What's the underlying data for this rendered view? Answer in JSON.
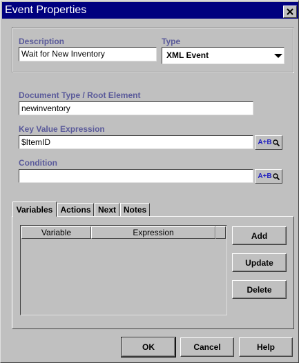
{
  "window": {
    "title": "Event Properties"
  },
  "header_group": {
    "description_label": "Description",
    "description_value": "Wait for New Inventory",
    "type_label": "Type",
    "type_value": "XML Event"
  },
  "doc_type": {
    "label": "Document Type / Root Element",
    "value": "newinventory"
  },
  "key_value": {
    "label": "Key Value Expression",
    "value": "$ItemID",
    "button_label": "A+B"
  },
  "condition": {
    "label": "Condition",
    "value": "",
    "button_label": "A+B"
  },
  "tabs": [
    {
      "label": "Variables"
    },
    {
      "label": "Actions"
    },
    {
      "label": "Next"
    },
    {
      "label": "Notes"
    }
  ],
  "variables_table": {
    "columns": [
      "Variable",
      "Expression"
    ]
  },
  "side_buttons": {
    "add": "Add",
    "update": "Update",
    "delete": "Delete"
  },
  "footer_buttons": {
    "ok": "OK",
    "cancel": "Cancel",
    "help": "Help"
  },
  "icons": {
    "close": "close-icon",
    "dropdown": "chevron-down-icon",
    "expression": "magnifier-icon"
  },
  "colors": {
    "title_bar": "#00007f",
    "label_text": "#5a5a9a",
    "expr_button_text": "#2020c0"
  }
}
